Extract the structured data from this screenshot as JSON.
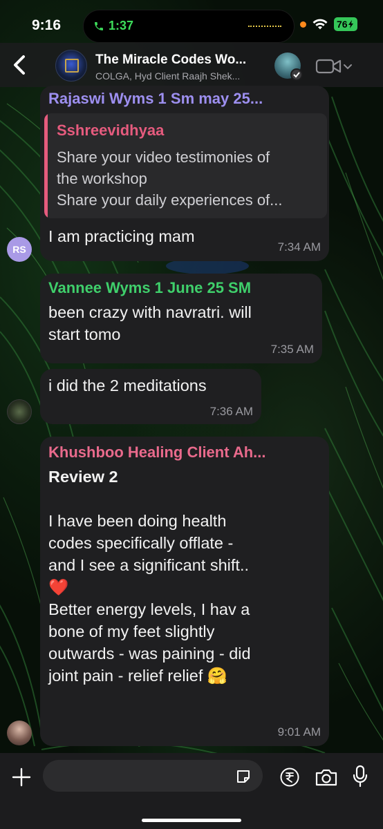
{
  "status_bar": {
    "time": "9:16",
    "call_timer": "1:37",
    "battery": "76"
  },
  "header": {
    "title": "The Miracle Codes Wo...",
    "subtitle": "COLGA, Hyd Client Raajh Shek..."
  },
  "messages": [
    {
      "sender": "Rajaswi Wyms 1 Sm may 25...",
      "sender_color": "#9d8ff0",
      "avatar_initials": "RS",
      "quote": {
        "name": "Sshreevidhyaa",
        "line1": "Share your video testimonies of",
        "line2": "the workshop",
        "line3": "Share your daily experiences of..."
      },
      "text": "I am practicing mam",
      "time": "7:34 AM"
    },
    {
      "sender": "Vannee Wyms 1 June 25 SM",
      "sender_color": "#3fcf6b",
      "line1": "been crazy with navratri. will",
      "line2": "start tomo",
      "time": "7:35 AM"
    },
    {
      "text": "i did the 2 meditations",
      "time": "7:36 AM"
    },
    {
      "sender": "Khushboo Healing Client Ah...",
      "sender_color": "#e96a8c",
      "title": "Review 2",
      "p1": "I have been doing health",
      "p2": "codes specifically offlate -",
      "p3": "and I see a significant shift..",
      "p4": "❤️",
      "p5": "Better energy levels, I hav a",
      "p6": "bone of my feet slightly",
      "p7": "outwards - was paining - did",
      "p8": "joint pain - relief relief 🤗",
      "time": "9:01 AM"
    }
  ],
  "composer": {
    "placeholder": ""
  },
  "icons": [
    "back-icon",
    "video-call-icon",
    "plus-icon",
    "sticker-icon",
    "rupee-icon",
    "camera-icon",
    "mic-icon",
    "phone-icon",
    "wifi-icon"
  ]
}
